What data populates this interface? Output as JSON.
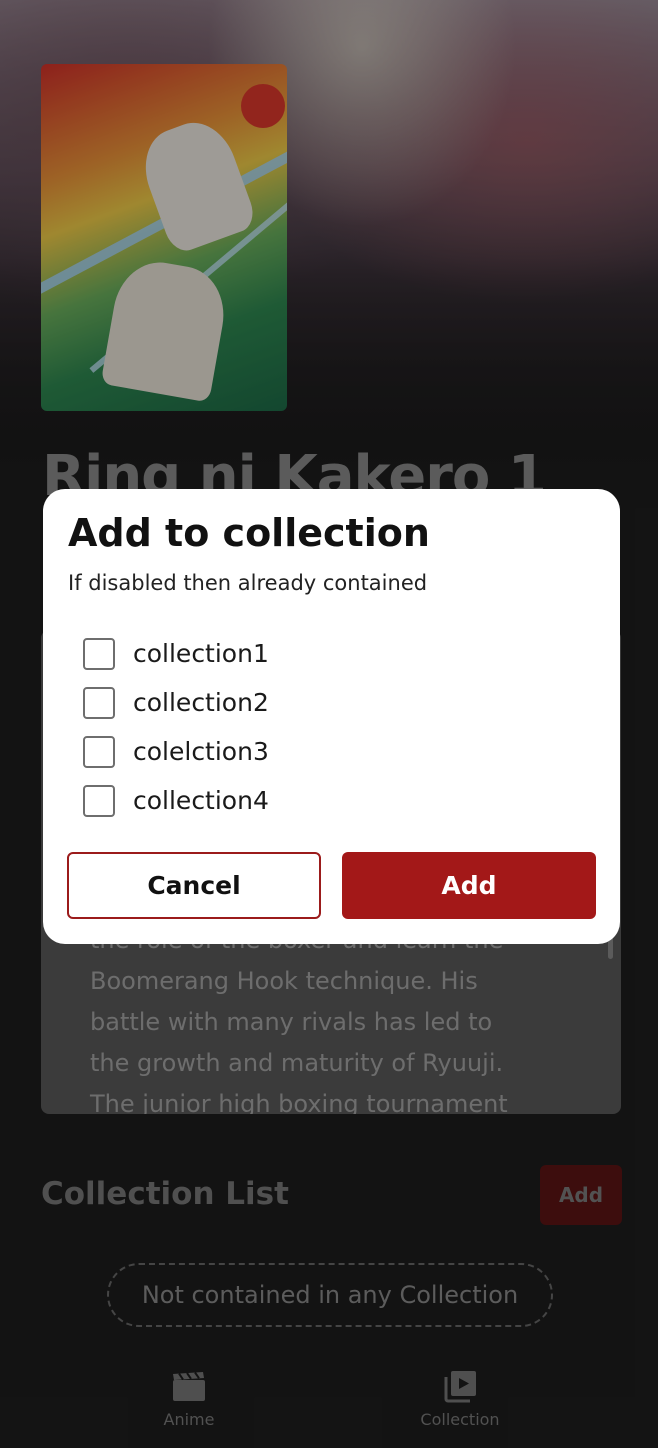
{
  "anime": {
    "title": "Ring ni Kakero 1",
    "synopsis_lines": [
      "the role of the boxer and learn the",
      "Boomerang Hook technique. His",
      "battle with many rivals has led to",
      "the growth and maturity of Ryuuji.",
      "The junior high boxing tournament"
    ]
  },
  "collection_section": {
    "title": "Collection List",
    "add_label": "Add",
    "empty_text": "Not contained in any Collection"
  },
  "bottom_nav": {
    "items": [
      {
        "label": "Anime",
        "icon": "clapperboard-icon"
      },
      {
        "label": "Collection",
        "icon": "video-library-icon"
      }
    ]
  },
  "dialog": {
    "title": "Add to collection",
    "subtitle": "If disabled then already contained",
    "options": [
      {
        "label": "collection1",
        "checked": false
      },
      {
        "label": "collection2",
        "checked": false
      },
      {
        "label": "colelction3",
        "checked": false
      },
      {
        "label": "collection4",
        "checked": false
      }
    ],
    "cancel_label": "Cancel",
    "add_label": "Add"
  },
  "colors": {
    "accent": "#a31818",
    "background": "#1e1e1e"
  }
}
